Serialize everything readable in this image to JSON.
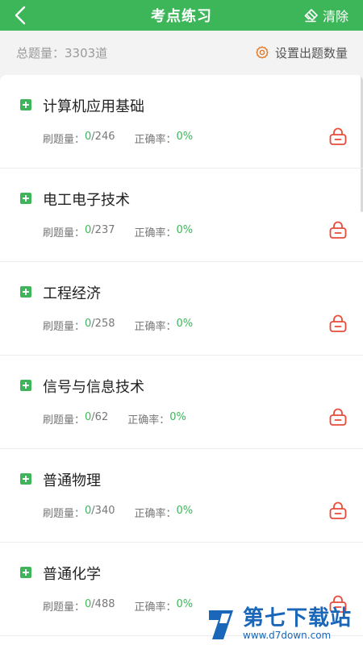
{
  "header": {
    "title": "考点练习",
    "clear_label": "清除",
    "back_icon": "chevron-left-icon",
    "clear_icon": "eraser-icon"
  },
  "summary": {
    "total_label": "总题量：3303道",
    "set_count_label": "设置出题数量",
    "set_icon": "gear-icon"
  },
  "labels": {
    "done": "刷题量：",
    "rate": "正确率："
  },
  "colors": {
    "accent": "#3cb659",
    "lock": "#e94a3a"
  },
  "items": [
    {
      "name": "计算机应用基础",
      "done": "0",
      "total": "/246",
      "rate": "0%"
    },
    {
      "name": "电工电子技术",
      "done": "0",
      "total": "/237",
      "rate": "0%"
    },
    {
      "name": "工程经济",
      "done": "0",
      "total": "/258",
      "rate": "0%"
    },
    {
      "name": "信号与信息技术",
      "done": "0",
      "total": "/62",
      "rate": "0%"
    },
    {
      "name": "普通物理",
      "done": "0",
      "total": "/340",
      "rate": "0%"
    },
    {
      "name": "普通化学",
      "done": "0",
      "total": "/488",
      "rate": "0%"
    }
  ],
  "watermark": {
    "title": "第七下载站",
    "url": "www.d7down.com"
  }
}
